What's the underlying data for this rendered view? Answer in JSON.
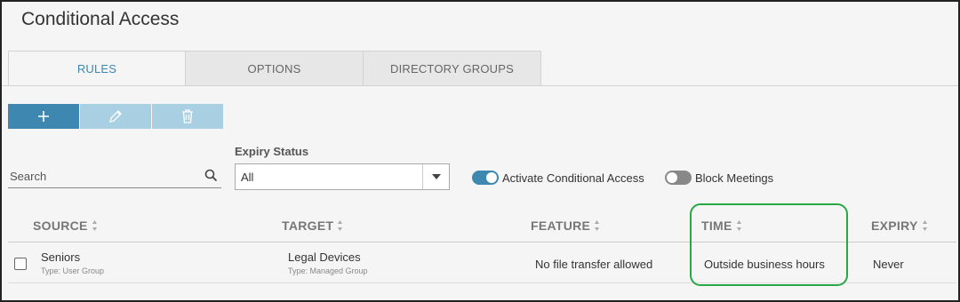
{
  "page": {
    "title": "Conditional Access"
  },
  "tabs": [
    {
      "label": "RULES",
      "active": true
    },
    {
      "label": "OPTIONS",
      "active": false
    },
    {
      "label": "DIRECTORY GROUPS",
      "active": false
    }
  ],
  "toolbar": {
    "add_icon": "plus-icon",
    "edit_icon": "pencil-icon",
    "delete_icon": "trash-icon"
  },
  "filters": {
    "search": {
      "placeholder": "Search",
      "value": ""
    },
    "expiry_status": {
      "label": "Expiry Status",
      "selected": "All"
    },
    "activate_toggle": {
      "label": "Activate Conditional Access",
      "on": true
    },
    "block_meetings_toggle": {
      "label": "Block Meetings",
      "on": false
    }
  },
  "table": {
    "columns": [
      "SOURCE",
      "TARGET",
      "FEATURE",
      "TIME",
      "EXPIRY"
    ],
    "rows": [
      {
        "source": "Seniors",
        "source_type": "Type: User Group",
        "target": "Legal Devices",
        "target_type": "Type: Managed Group",
        "feature": "No file transfer allowed",
        "time": "Outside business hours",
        "expiry": "Never"
      }
    ]
  },
  "colors": {
    "accent": "#3d87b0",
    "accent_disabled": "#a8cfe2",
    "highlight": "#27a845"
  }
}
